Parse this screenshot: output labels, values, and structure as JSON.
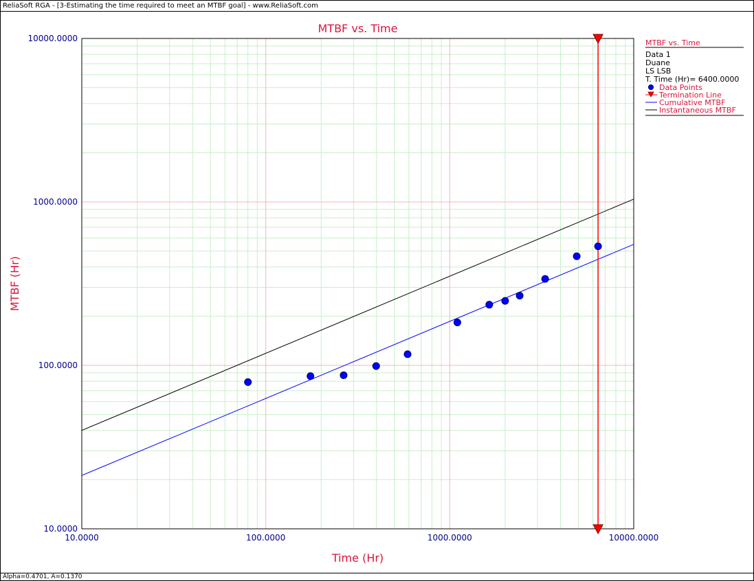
{
  "window": {
    "title": "ReliaSoft RGA - [3-Estimating the time required to meet an MTBF goal] - www.ReliaSoft.com"
  },
  "status": {
    "text": "Alpha=0.4701, A=0.1370"
  },
  "colors": {
    "accent": "#dc143c",
    "tick": "#00008b",
    "points": "#0000ff",
    "cumulative": "#0000ff",
    "instantaneous": "#000000",
    "termination": "#ff0000",
    "major_grid": "#f4b4b4",
    "minor_grid": "#c8efc8"
  },
  "legend": {
    "title": "MTBF vs. Time",
    "info": [
      "Data 1",
      "Duane",
      "LS LSB",
      "T. Time (Hr)= 6400.0000"
    ],
    "items": [
      {
        "label": "Data Points",
        "marker": "circle"
      },
      {
        "label": "Termination Line",
        "marker": "triangle-line"
      },
      {
        "label": "Cumulative MTBF",
        "marker": "line-blue"
      },
      {
        "label": "Instantaneous MTBF",
        "marker": "line-black"
      }
    ]
  },
  "chart_data": {
    "type": "scatter",
    "title": "MTBF vs. Time",
    "xlabel": "Time (Hr)",
    "ylabel": "MTBF (Hr)",
    "xscale": "log",
    "yscale": "log",
    "xlim": [
      10,
      10000
    ],
    "ylim": [
      10,
      10000
    ],
    "x_ticks": [
      "10.0000",
      "100.0000",
      "1000.0000",
      "10000.0000"
    ],
    "y_ticks": [
      "10.0000",
      "100.0000",
      "1000.0000",
      "10000.0000"
    ],
    "grid": true,
    "legend_position": "right",
    "series": [
      {
        "name": "Data Points",
        "kind": "points",
        "x": [
          80,
          175,
          265,
          398,
          590,
          1100,
          1640,
          2000,
          2400,
          3300,
          4900,
          6400
        ],
        "y": [
          79,
          86,
          87,
          99,
          117,
          183,
          235,
          248,
          267,
          338,
          465,
          535
        ]
      },
      {
        "name": "Cumulative MTBF",
        "kind": "line",
        "x": [
          10,
          10000
        ],
        "y": [
          21.2,
          550
        ]
      },
      {
        "name": "Instantaneous MTBF",
        "kind": "line",
        "x": [
          10,
          10000
        ],
        "y": [
          40,
          1040
        ]
      },
      {
        "name": "Termination Line",
        "kind": "vline",
        "x": 6400
      }
    ]
  }
}
